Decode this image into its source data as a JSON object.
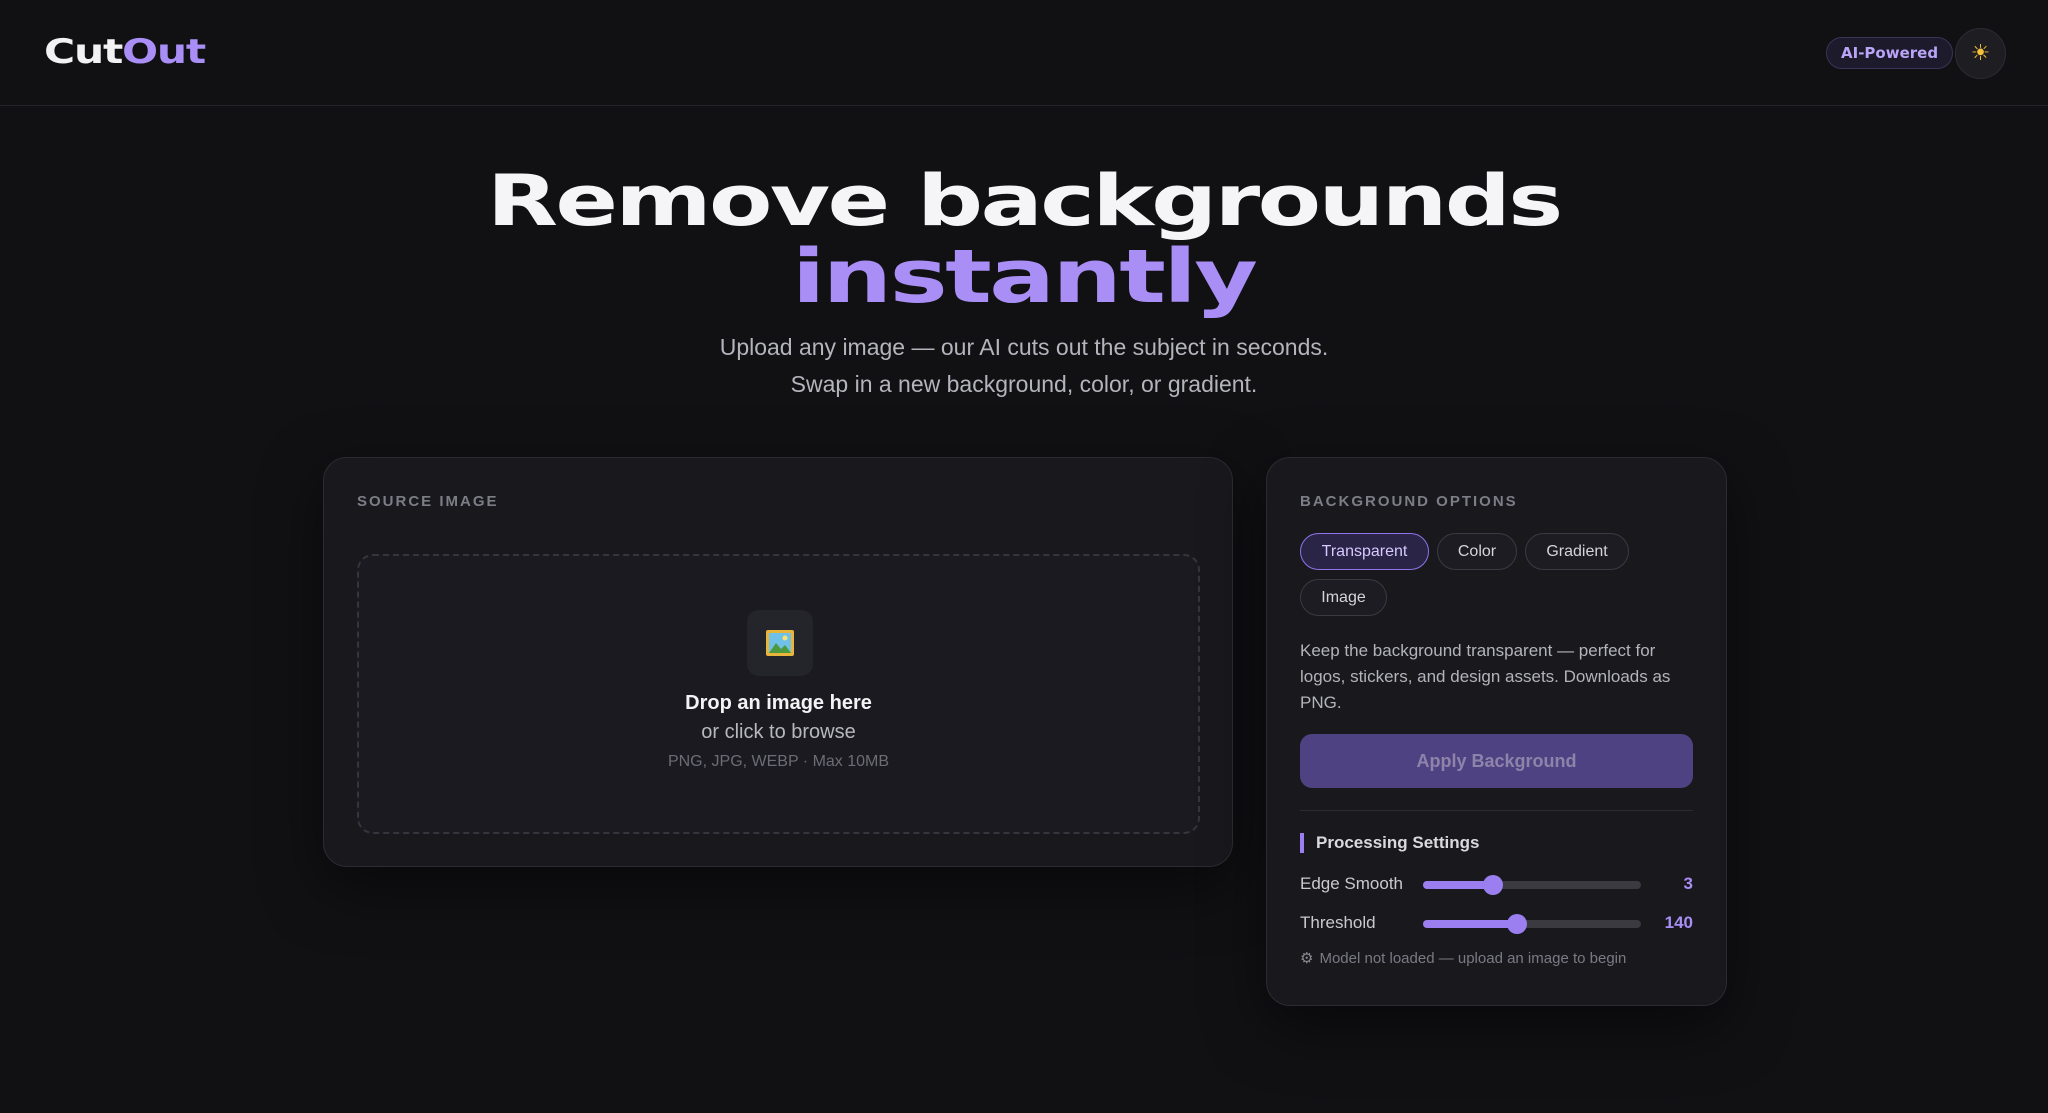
{
  "header": {
    "logo_part1": "Cut",
    "logo_part2": "Out",
    "badge": "AI-Powered",
    "theme_icon": "sun-icon"
  },
  "hero": {
    "title_line1": "Remove backgrounds",
    "title_line2": "instantly",
    "subtitle_line1": "Upload any image — our AI cuts out the subject in seconds.",
    "subtitle_line2": "Swap in a new background, color, or gradient."
  },
  "source": {
    "label": "SOURCE IMAGE",
    "icon": "picture-icon",
    "drop_title": "Drop an image here",
    "drop_sub": "or click to browse",
    "drop_hint": "PNG, JPG, WEBP · Max 10MB"
  },
  "options": {
    "label": "BACKGROUND OPTIONS",
    "chips": [
      "Transparent",
      "Color",
      "Gradient",
      "Image"
    ],
    "selected": "Transparent",
    "description": "Keep the background transparent — perfect for logos, stickers, and design assets. Downloads as PNG.",
    "apply_label": "Apply Background",
    "processing_title": "Processing Settings",
    "edge_smooth": {
      "label": "Edge Smooth",
      "value": "3",
      "fraction": 0.32
    },
    "threshold": {
      "label": "Threshold",
      "value": "140",
      "fraction": 0.43
    },
    "status": "Model not loaded — upload an image to begin"
  },
  "colors": {
    "accent": "#a98ef5",
    "background": "#111114",
    "card": "#18181d"
  }
}
